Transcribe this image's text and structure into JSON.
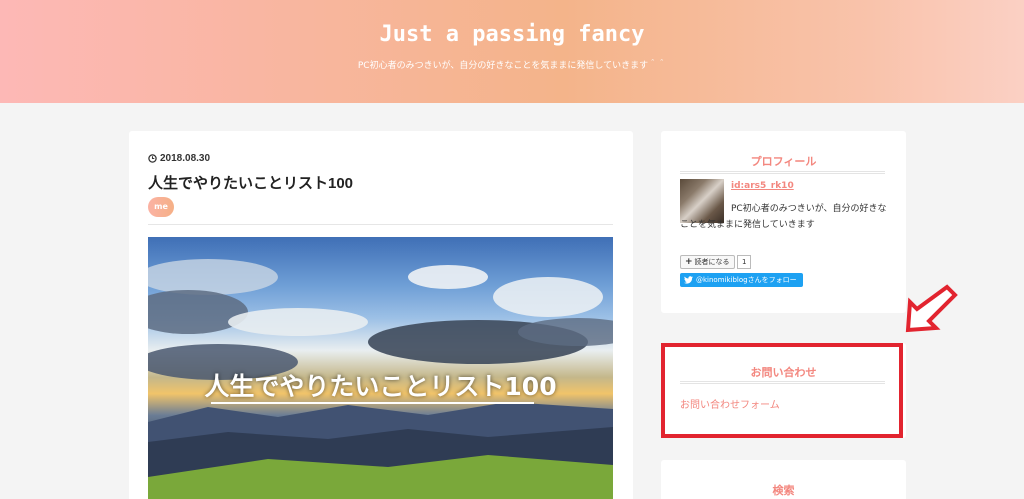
{
  "header": {
    "title": "Just a passing fancy",
    "description": "PC初心者のみつきいが、自分の好きなことを気ままに発信していきます＾＾"
  },
  "post": {
    "date": "2018.08.30",
    "title": "人生でやりたいことリスト100",
    "category": "me",
    "hero_text": "人生でやりたいことリスト100"
  },
  "sidebar": {
    "profile": {
      "heading": "プロフィール",
      "user_id": "id:ars5_rk10",
      "bio": "PC初心者のみつきいが、自分の好きなことを気ままに発信していきます",
      "reader_button": "読者になる",
      "reader_count": "1",
      "follow_button": "@kinomikiblogさんをフォロー"
    },
    "contact": {
      "heading": "お問い合わせ",
      "link": "お問い合わせフォーム"
    },
    "search": {
      "heading": "検索"
    }
  },
  "colors": {
    "accent": "#f3877f",
    "annotation_red": "#e2242f",
    "twitter": "#1da1f2"
  }
}
